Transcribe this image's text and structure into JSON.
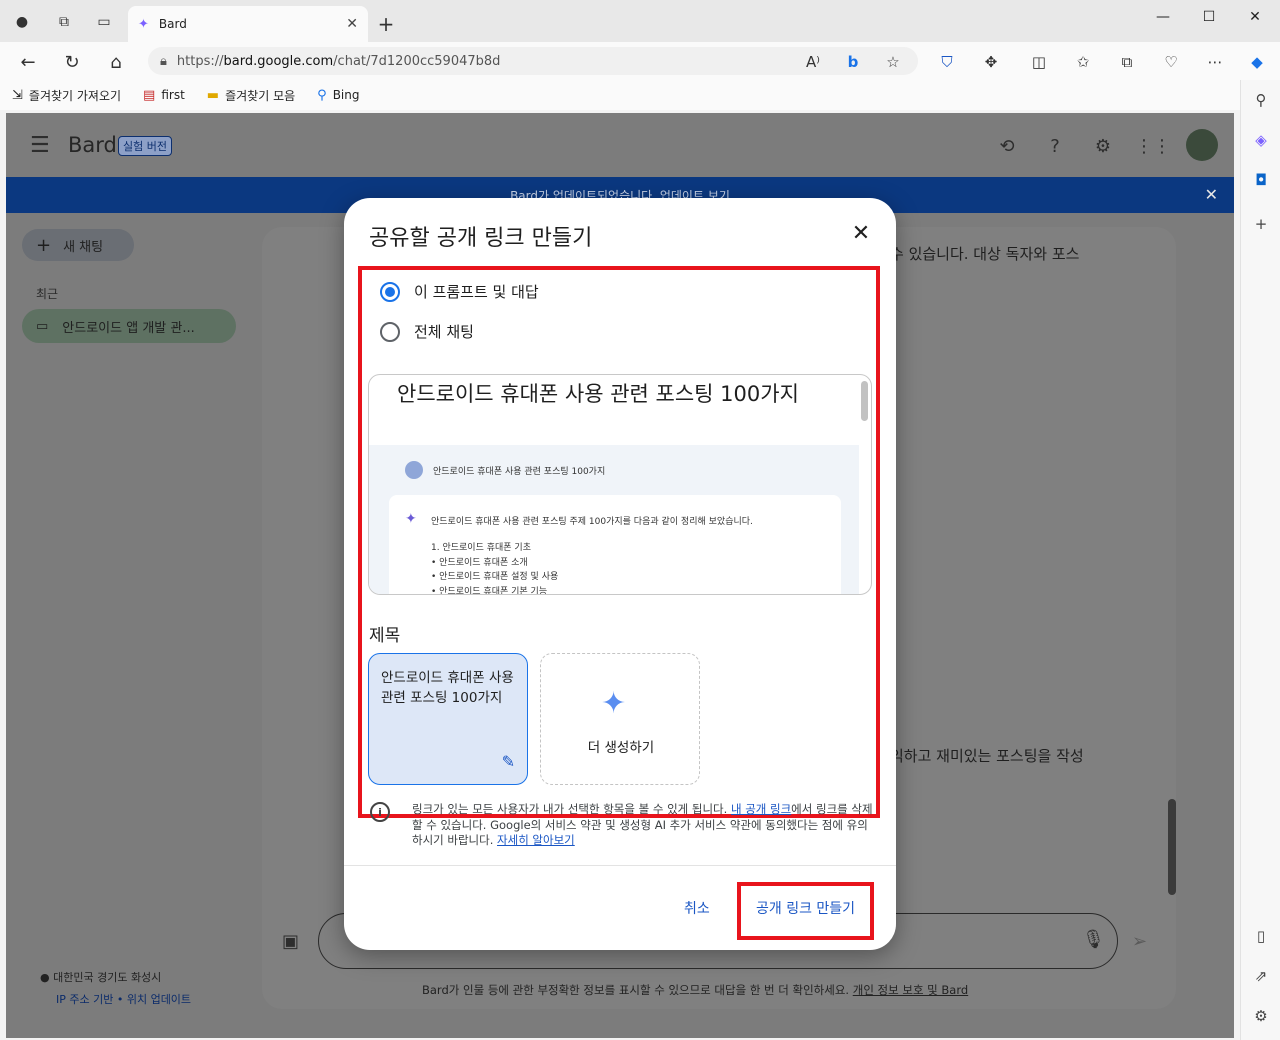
{
  "browser": {
    "tab_title": "Bard",
    "url_scheme": "https://",
    "url_host": "bard.google.com",
    "url_path": "/chat/7d1200cc59047b8d",
    "favorites": [
      {
        "label": "즐겨찾기 가져오기",
        "icon": "import-icon"
      },
      {
        "label": "first",
        "icon": "pdf-icon"
      },
      {
        "label": "즐겨찾기 모음",
        "icon": "folder-icon"
      },
      {
        "label": "Bing",
        "icon": "search-icon"
      }
    ]
  },
  "bard": {
    "brand": "Bard",
    "badge": "실험 버전",
    "banner": "Bard가 업데이트되었습니다. 업데이트 보기",
    "new_chat": "새 채팅",
    "recent_label": "최근",
    "recent_item": "안드로이드 앱 개발 관...",
    "peek_top": "수 있습니다. 대상 독자와 포스",
    "peek_bottom": "익하고 재미있는 포스팅을 작성",
    "location": "대한민국 경기도 화성시",
    "location_update": "IP 주소 기반 • 위치 업데이트",
    "disclaimer": "Bard가 인물 등에 관한 부정확한 정보를 표시할 수 있으므로 대답을 한 번 더 확인하세요.",
    "disclaimer_link": "개인 정보 보호 및 Bard"
  },
  "dialog": {
    "title": "공유할 공개 링크 만들기",
    "option_prompt": "이 프롬프트 및 대답",
    "option_all": "전체 채팅",
    "preview": {
      "title": "안드로이드 휴대폰 사용 관련 포스팅 100가지",
      "user_prompt": "안드로이드 휴대폰 사용 관련 포스팅 100가지",
      "intro": "안드로이드 휴대폰 사용 관련 포스팅 주제 100가지를 다음과 같이 정리해 보았습니다.",
      "list": [
        "1. 안드로이드 휴대폰 기초",
        "• 안드로이드 휴대폰 소개",
        "• 안드로이드 휴대폰 설정 및 사용",
        "• 안드로이드 휴대폰 기본 기능"
      ]
    },
    "section_title": "제목",
    "title_option": "안드로이드 휴대폰 사용 관련 포스팅 100가지",
    "generate_more": "더 생성하기",
    "info_text": "링크가 있는 모든 사용자가 내가 선택한 항목을 볼 수 있게 됩니다. ",
    "info_link1": "내 공개 링크",
    "info_text2": "에서 링크를 삭제할 수 있습니다. Google의 서비스 약관 및 생성형 AI 추가 서비스 약관에 동의했다는 점에 유의하시기 바랍니다. ",
    "info_link2": "자세히 알아보기",
    "cancel": "취소",
    "create": "공개 링크 만들기",
    "selected_option": "이 프롬프트 및 대답",
    "highlight_color": "#e8141c",
    "accent_color": "#1a73e8"
  }
}
